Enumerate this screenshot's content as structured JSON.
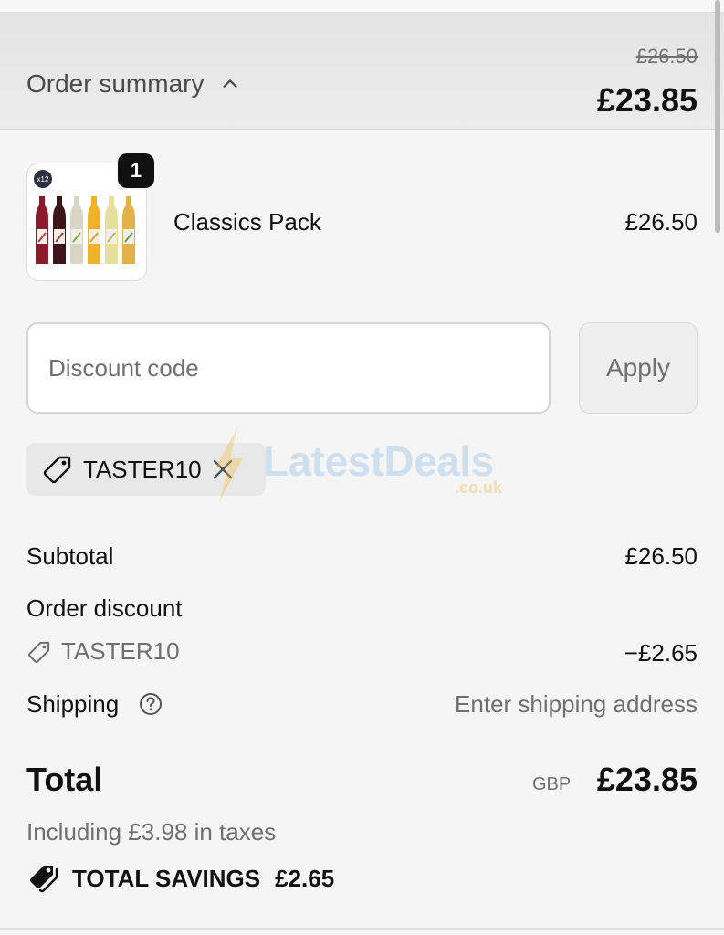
{
  "summary": {
    "toggle_label": "Order summary",
    "original_price": "£26.50",
    "total_price": "£23.85"
  },
  "line_item": {
    "quantity": "1",
    "name": "Classics Pack",
    "price": "£26.50",
    "image_badge": "x12"
  },
  "discount": {
    "placeholder": "Discount code",
    "apply_label": "Apply",
    "applied_code": "TASTER10"
  },
  "watermark": {
    "main": "LatestDeals",
    "sub": ".co.uk"
  },
  "totals": {
    "subtotal_label": "Subtotal",
    "subtotal_value": "£26.50",
    "order_discount_label": "Order discount",
    "discount_code": "TASTER10",
    "discount_value": "−£2.65",
    "shipping_label": "Shipping",
    "shipping_value": "Enter shipping address",
    "total_label": "Total",
    "currency": "GBP",
    "total_value": "£23.85",
    "tax_note": "Including £3.98 in taxes",
    "savings_label": "TOTAL SAVINGS",
    "savings_value": "£2.65"
  },
  "icons": {
    "summary_toggle": "chevron-up-icon",
    "chip_tag": "tag-icon",
    "chip_remove": "close-icon",
    "discount_tag": "tag-icon",
    "shipping_help": "question-circle-icon",
    "savings": "tags-icon"
  },
  "colors": {
    "accent": "#111111",
    "muted_text": "#6f6f6f",
    "summary_bar": "#e8e8e8",
    "chip_bg": "#e8e8e8",
    "bottle_colors": [
      "#8b1a2b",
      "#3d1518",
      "#d9d7c4",
      "#f0b22a",
      "#e7df9c",
      "#e3b04a"
    ]
  }
}
